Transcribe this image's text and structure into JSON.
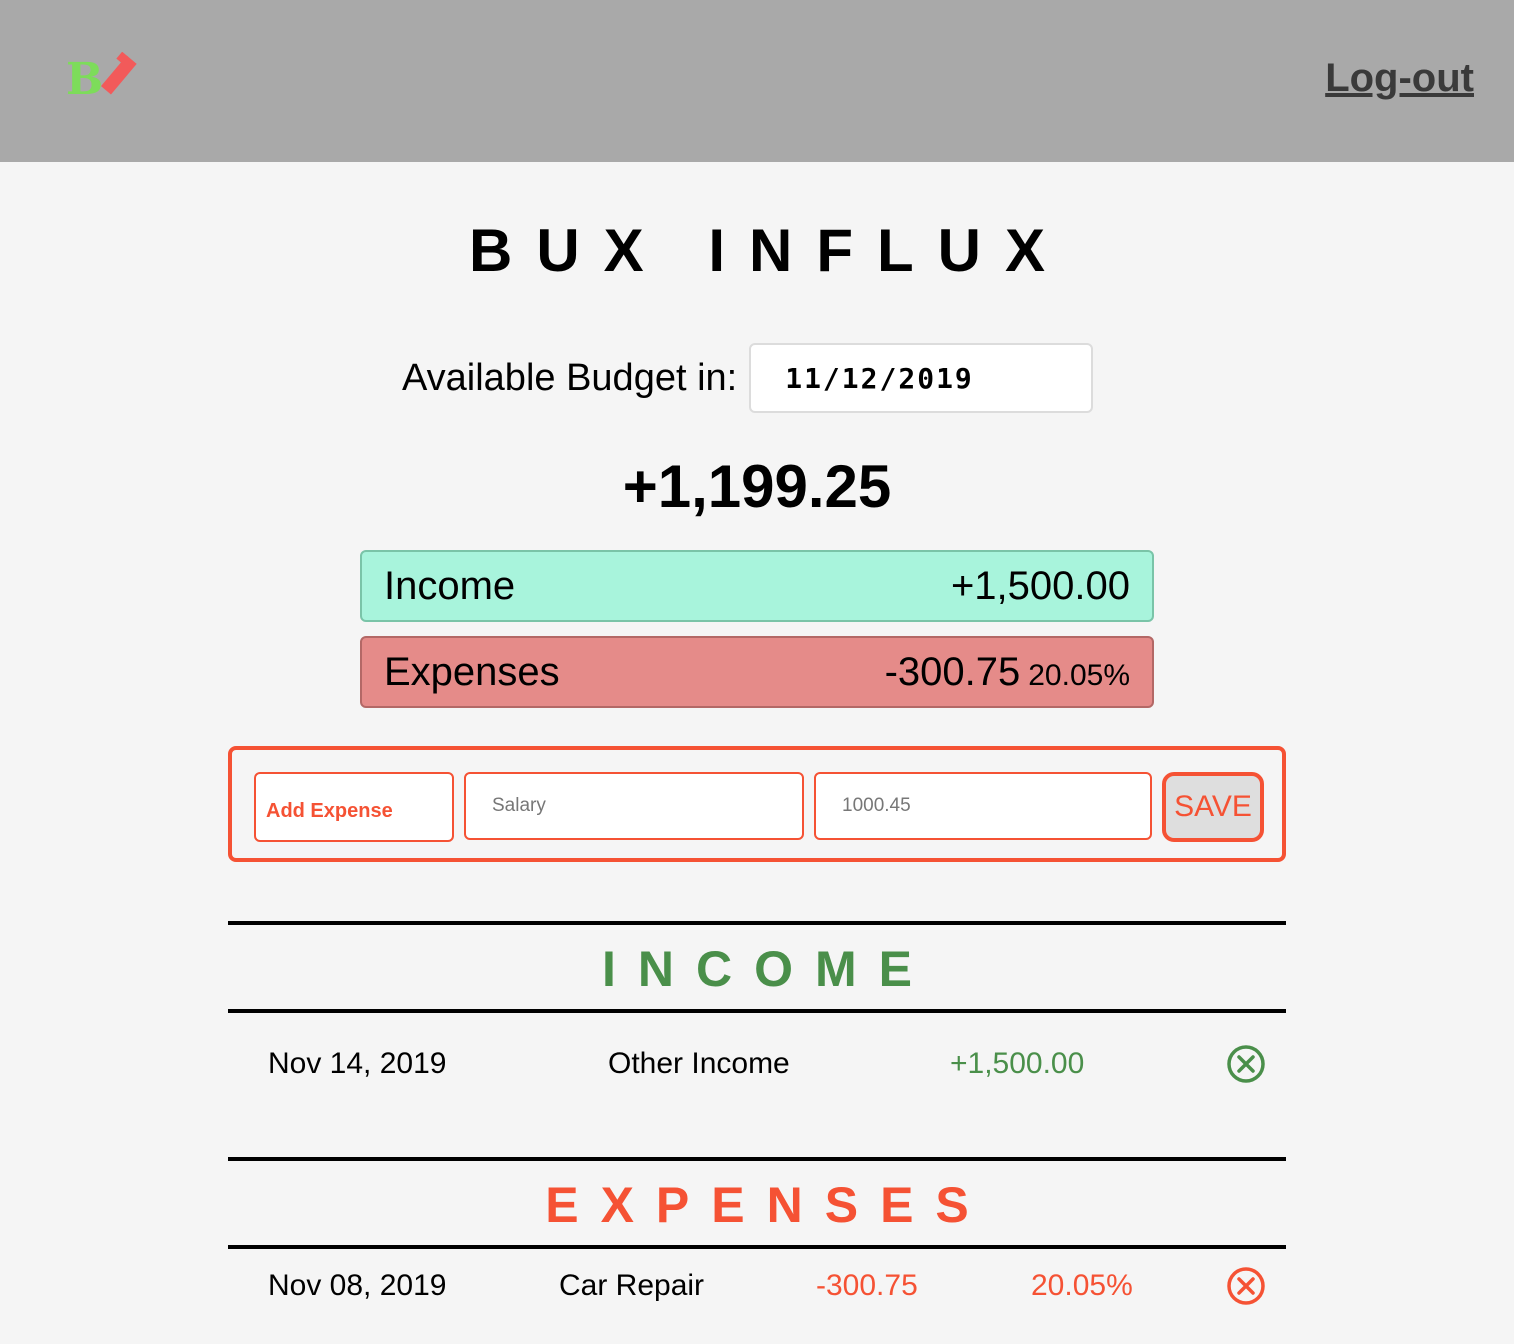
{
  "header": {
    "logo_text": "BI",
    "logout_label": "Log-out"
  },
  "app_title": "BUX INFLUX",
  "budget": {
    "label": "Available Budget in:",
    "date_value": "11/12/2019",
    "value": "+1,199.25"
  },
  "summary": {
    "income_label": "Income",
    "income_value": "+1,500.00",
    "expenses_label": "Expenses",
    "expenses_value": "-300.75",
    "expenses_percentage": "20.05%"
  },
  "add_form": {
    "type_selected": "Add Expense",
    "description_placeholder": "Salary",
    "value_placeholder": "1000.45",
    "save_label": "SAVE"
  },
  "income_section": {
    "title": "INCOME",
    "items": [
      {
        "date": "Nov 14, 2019",
        "description": "Other Income",
        "value": "+1,500.00"
      }
    ]
  },
  "expenses_section": {
    "title": "EXPENSES",
    "items": [
      {
        "date": "Nov 08, 2019",
        "description": "Car Repair",
        "value": "-300.75",
        "percentage": "20.05%"
      }
    ]
  },
  "colors": {
    "header_bg": "#a9a9a9",
    "page_bg": "#f5f5f5",
    "income_green": "#4a8f4a",
    "expense_red": "#f55234",
    "income_box": "#a8f4dc",
    "expense_box": "#e58b89",
    "logo_green": "#7ddc5a",
    "logo_red": "#f25a5a"
  }
}
